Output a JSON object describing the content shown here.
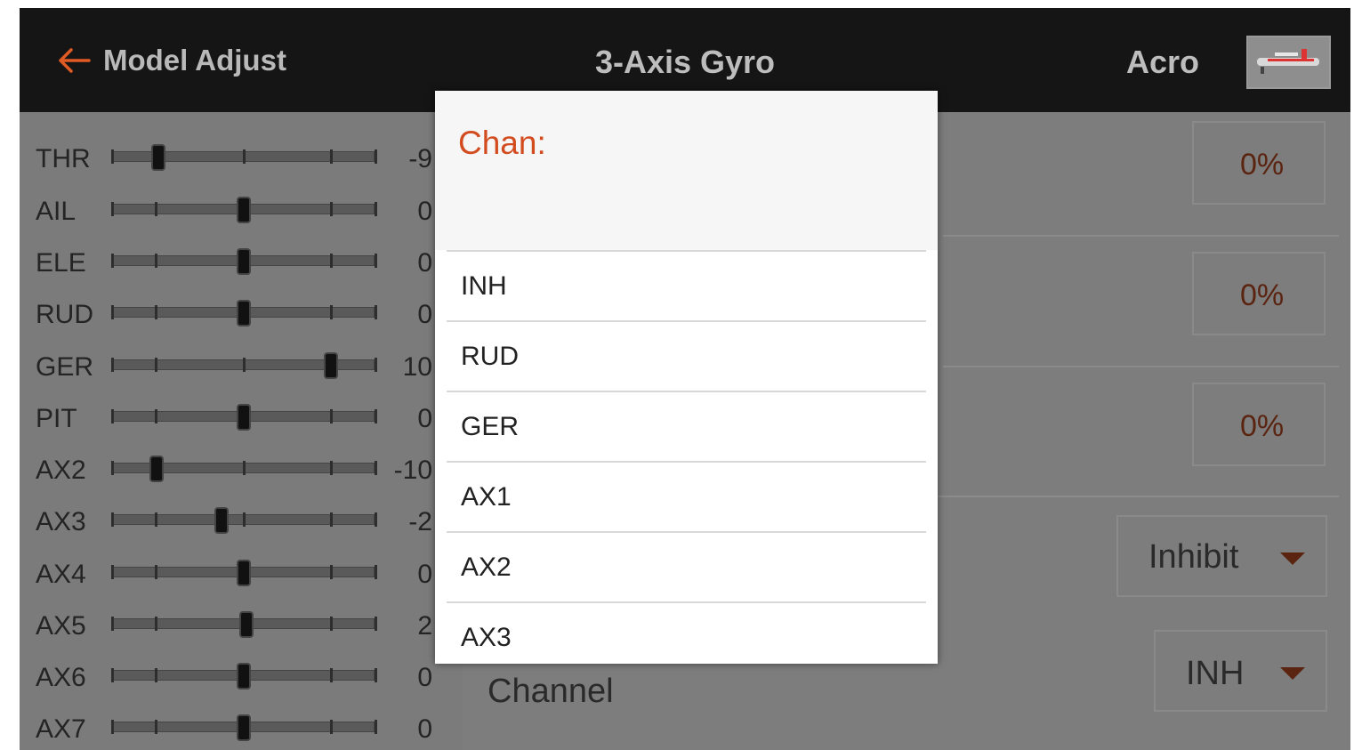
{
  "header": {
    "back_label": "Model Adjust",
    "title": "3-Axis Gyro",
    "model_name": "Acro",
    "back_icon": "back-arrow-icon",
    "accent_color": "#e05a24"
  },
  "channels": [
    {
      "label": "THR",
      "value": "-9",
      "position_percent": -65
    },
    {
      "label": "AIL",
      "value": "0",
      "position_percent": 0
    },
    {
      "label": "ELE",
      "value": "0",
      "position_percent": 0
    },
    {
      "label": "RUD",
      "value": "0",
      "position_percent": 0
    },
    {
      "label": "GER",
      "value": "10",
      "position_percent": 66
    },
    {
      "label": "PIT",
      "value": "0",
      "position_percent": 0
    },
    {
      "label": "AX2",
      "value": "-10",
      "position_percent": -66
    },
    {
      "label": "AX3",
      "value": "-2",
      "position_percent": -17
    },
    {
      "label": "AX4",
      "value": "0",
      "position_percent": 0
    },
    {
      "label": "AX5",
      "value": "2",
      "position_percent": 2
    },
    {
      "label": "AX6",
      "value": "0",
      "position_percent": 0
    },
    {
      "label": "AX7",
      "value": "0",
      "position_percent": 0
    }
  ],
  "settings": {
    "values": [
      "0%",
      "0%",
      "0%"
    ],
    "mode_dropdown": "Inhibit",
    "channel_label": "Channel",
    "channel_dropdown": "INH"
  },
  "dialog": {
    "title": "Chan:",
    "options": [
      "INH",
      "RUD",
      "GER",
      "AX1",
      "AX2",
      "AX3"
    ]
  }
}
